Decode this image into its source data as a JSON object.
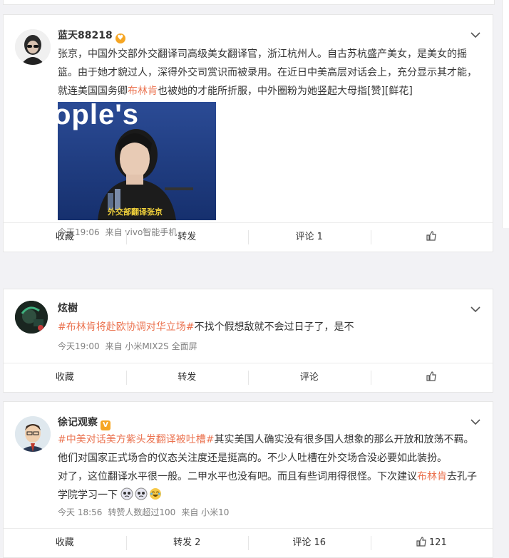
{
  "posts": [
    {
      "author": "蓝天88218",
      "badge": "😍",
      "text_before_link": "张京，中国外交部外交翻译司高级美女翻译官，浙江杭州人。自古苏杭盛产美女，是美女的摇篮。由于她才貌过人，深得外交司赏识而被录用。在近日中美高层对话会上，充分显示其才能，就连美国国务卿",
      "link": "布林肯",
      "text_after_link": "也被她的才能所折服，中外圈粉为她竖起大母指[赞][鲜花]",
      "image_overlay_top": "ople's",
      "image_caption": "外交部翻译张京",
      "meta_time": "今天19:06",
      "meta_source": "来自 vivo智能手机",
      "actions": {
        "favorite": "收藏",
        "repost": "转发",
        "comment": "评论 1",
        "like": ""
      }
    },
    {
      "author": "炫樹",
      "hashtag_link": "布林肯",
      "hashtag_rest": "将赴欧协调对华立场#",
      "hashtag_prefix": "#",
      "text": "不找个假想敌就不会过日子了，是不",
      "meta_time": "今天19:00",
      "meta_source": "来自 小米MIX2S 全面屏",
      "actions": {
        "favorite": "收藏",
        "repost": "转发",
        "comment": "评论",
        "like": ""
      }
    },
    {
      "author": "徐记观察",
      "vbadge": "V",
      "hashtag": "#中美对话美方紫头发翻译被吐槽#",
      "line1_rest": "其实美国人确实没有很多国人想象的那么开放和放荡不羁。",
      "line2": "他们对国家正式场合的仪态关注度还是挺高的。不少人吐槽在外交场合没必要如此装扮。",
      "line3_before": "对了，这位翻译水平很一般。二甲水平也没有吧。而且有些词用得很怪。下次建议",
      "line3_link": "布林肯",
      "line3_after": "去孔子",
      "line4": "学院学习一下",
      "meta_time": "今天 18:56",
      "meta_extra": "转赞人数超过100",
      "meta_source": "来自 小米10",
      "actions": {
        "favorite": "收藏",
        "repost": "转发 2",
        "comment": "评论 16",
        "like": "121"
      }
    }
  ],
  "colors": {
    "accent": "#eb7350",
    "meta": "#808080",
    "badge": "#f6a623"
  }
}
